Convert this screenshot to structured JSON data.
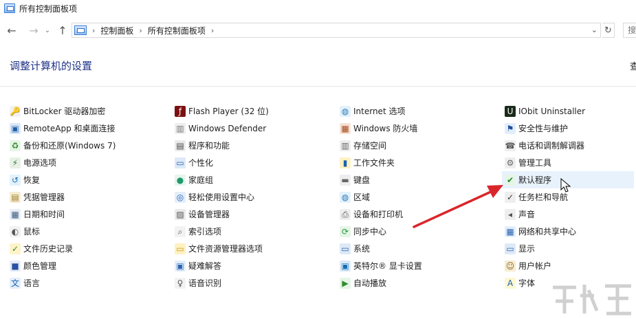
{
  "window": {
    "title": "所有控制面板项"
  },
  "nav": {
    "back": "←",
    "forward": "→",
    "recent": "⌄",
    "up": "↑",
    "breadcrumb": [
      "控制面板",
      "所有控制面板项"
    ],
    "separator": "›",
    "dropdown": "⌄",
    "refresh": "↻",
    "search_placeholder": "搜"
  },
  "main": {
    "heading": "调整计算机的设置",
    "view_by": "查"
  },
  "columns": [
    [
      {
        "label": "BitLocker 驱动器加密",
        "icon": "bitlocker-icon"
      },
      {
        "label": "RemoteApp 和桌面连接",
        "icon": "remoteapp-icon"
      },
      {
        "label": "备份和还原(Windows 7)",
        "icon": "backup-icon"
      },
      {
        "label": "电源选项",
        "icon": "power-icon"
      },
      {
        "label": "恢复",
        "icon": "recovery-icon"
      },
      {
        "label": "凭据管理器",
        "icon": "credential-icon"
      },
      {
        "label": "日期和时间",
        "icon": "calendar-icon"
      },
      {
        "label": "鼠标",
        "icon": "mouse-icon"
      },
      {
        "label": "文件历史记录",
        "icon": "file-history-icon"
      },
      {
        "label": "颜色管理",
        "icon": "color-management-icon"
      },
      {
        "label": "语言",
        "icon": "language-icon"
      }
    ],
    [
      {
        "label": "Flash Player (32 位)",
        "icon": "flash-icon"
      },
      {
        "label": "Windows Defender",
        "icon": "defender-icon"
      },
      {
        "label": "程序和功能",
        "icon": "programs-icon"
      },
      {
        "label": "个性化",
        "icon": "personalization-icon"
      },
      {
        "label": "家庭组",
        "icon": "homegroup-icon"
      },
      {
        "label": "轻松使用设置中心",
        "icon": "ease-of-access-icon"
      },
      {
        "label": "设备管理器",
        "icon": "device-manager-icon"
      },
      {
        "label": "索引选项",
        "icon": "indexing-icon"
      },
      {
        "label": "文件资源管理器选项",
        "icon": "folder-options-icon"
      },
      {
        "label": "疑难解答",
        "icon": "troubleshoot-icon"
      },
      {
        "label": "语音识别",
        "icon": "microphone-icon"
      }
    ],
    [
      {
        "label": "Internet 选项",
        "icon": "internet-icon"
      },
      {
        "label": "Windows 防火墙",
        "icon": "firewall-icon"
      },
      {
        "label": "存储空间",
        "icon": "storage-icon"
      },
      {
        "label": "工作文件夹",
        "icon": "work-folders-icon"
      },
      {
        "label": "键盘",
        "icon": "keyboard-icon"
      },
      {
        "label": "区域",
        "icon": "region-icon"
      },
      {
        "label": "设备和打印机",
        "icon": "printer-icon"
      },
      {
        "label": "同步中心",
        "icon": "sync-icon"
      },
      {
        "label": "系统",
        "icon": "system-icon"
      },
      {
        "label": "英特尔® 显卡设置",
        "icon": "intel-graphics-icon"
      },
      {
        "label": "自动播放",
        "icon": "autoplay-icon"
      }
    ],
    [
      {
        "label": "IObit Uninstaller",
        "icon": "iobit-icon"
      },
      {
        "label": "安全性与维护",
        "icon": "security-flag-icon"
      },
      {
        "label": "电话和调制解调器",
        "icon": "phone-modem-icon"
      },
      {
        "label": "管理工具",
        "icon": "admin-tools-icon"
      },
      {
        "label": "默认程序",
        "icon": "default-programs-icon"
      },
      {
        "label": "任务栏和导航",
        "icon": "taskbar-icon"
      },
      {
        "label": "声音",
        "icon": "sound-icon"
      },
      {
        "label": "网络和共享中心",
        "icon": "network-icon"
      },
      {
        "label": "显示",
        "icon": "display-icon"
      },
      {
        "label": "用户帐户",
        "icon": "user-accounts-icon"
      },
      {
        "label": "字体",
        "icon": "fonts-icon"
      }
    ]
  ],
  "annotation": {
    "arrow_color": "#d9262b"
  }
}
